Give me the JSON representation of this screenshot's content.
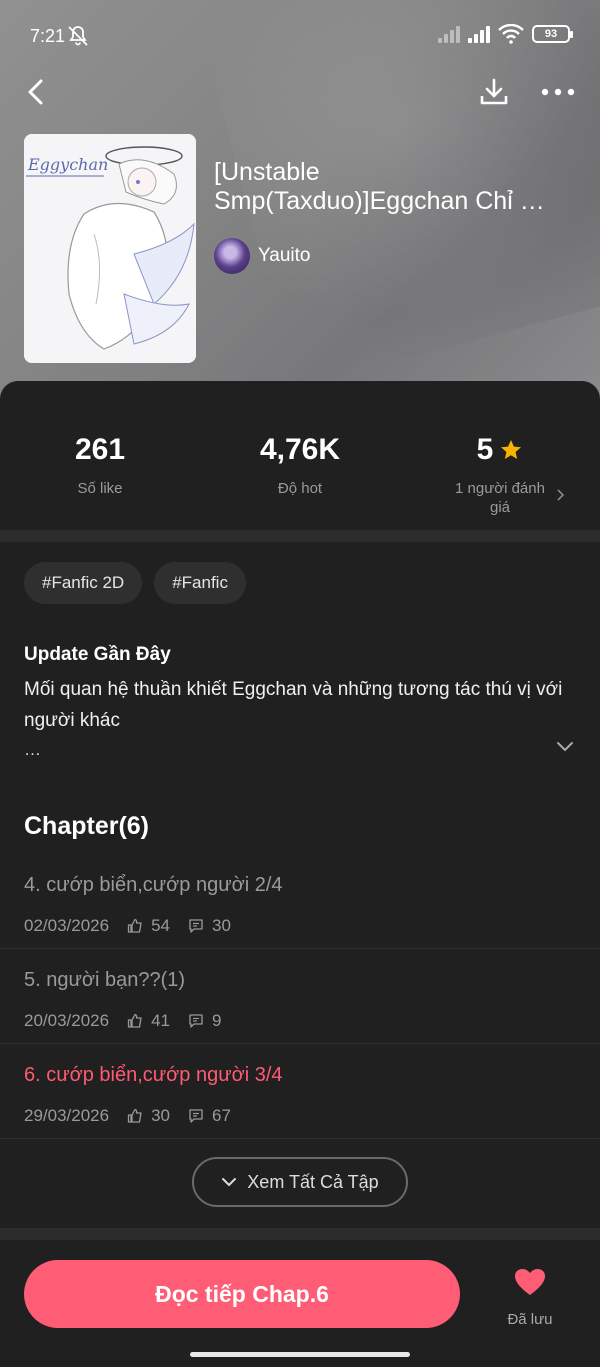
{
  "status_bar": {
    "time": "7:21",
    "battery": "93"
  },
  "book": {
    "title": "[Unstable Smp(Taxduo)]Eggchan Chỉ …",
    "author": "Yauito",
    "cover_text": "Eggychan"
  },
  "stats": [
    {
      "value": "261",
      "label": "Số like"
    },
    {
      "value": "4,76K",
      "label": "Độ hot"
    },
    {
      "value": "5",
      "label": "1 người đánh giá"
    }
  ],
  "tags": [
    "#Fanfic 2D",
    "#Fanfic"
  ],
  "update": {
    "title": "Update Gần Đây",
    "description": "Mối quan hệ thuần khiết  Eggchan và những tương tác thú vị với người khác",
    "more": "…"
  },
  "chapters_header": "Chapter(6)",
  "chapters": [
    {
      "title": "4. cướp biển,cướp người 2/4",
      "date": "02/03/2026",
      "likes": "54",
      "comments": "30"
    },
    {
      "title": "5. người bạn??(1)",
      "date": "20/03/2026",
      "likes": "41",
      "comments": "9"
    },
    {
      "title": "6. cướp biển,cướp người 3/4",
      "date": "29/03/2026",
      "likes": "30",
      "comments": "67"
    }
  ],
  "view_all_label": "Xem Tất Cả Tập",
  "read_button": "Đọc tiếp Chap.6",
  "saved_label": "Đã lưu",
  "colors": {
    "accent": "#ff5c75",
    "active_chapter": "#ff5a72",
    "star": "#f5b400",
    "background": "#202020"
  }
}
